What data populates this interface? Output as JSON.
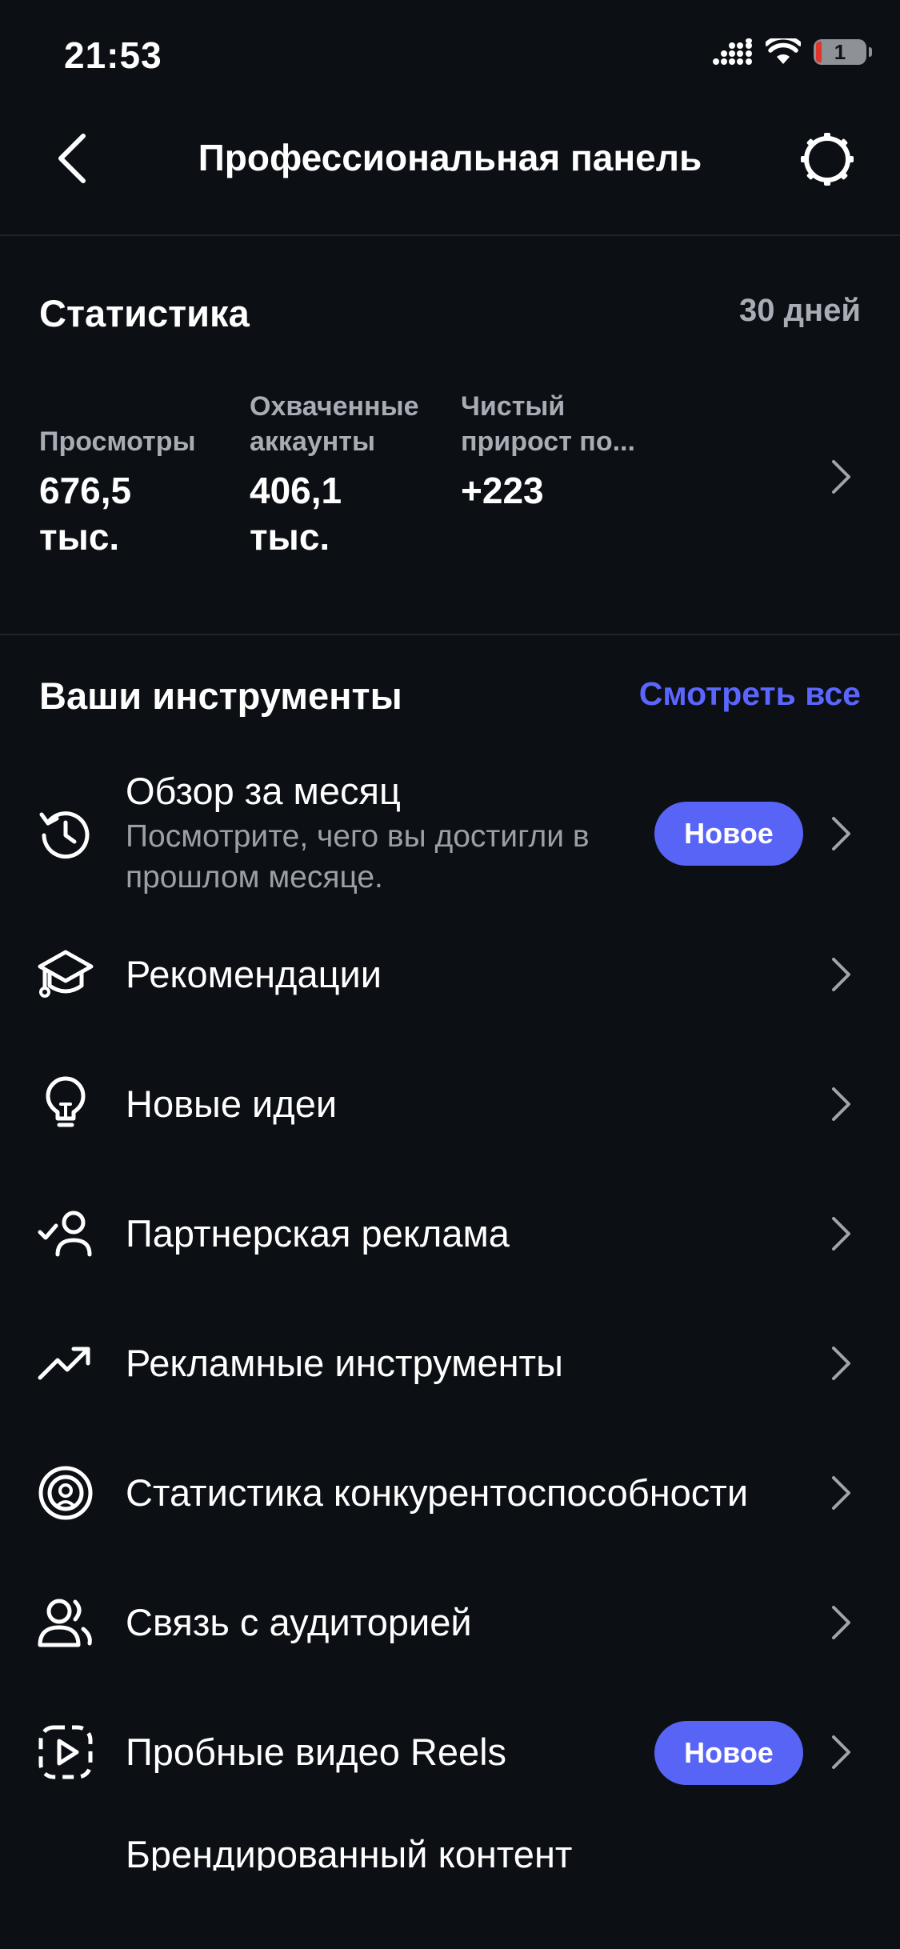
{
  "status_bar": {
    "time": "21:53",
    "battery": "1"
  },
  "header": {
    "title": "Профессиональная панель"
  },
  "stats": {
    "title": "Статистика",
    "range": "30 дней",
    "items": [
      {
        "label_line1": "",
        "label_line2": "Просмотры",
        "value_line1": "676,5",
        "value_line2": "тыс."
      },
      {
        "label_line1": "Охваченные",
        "label_line2": "аккаунты",
        "value_line1": "406,1",
        "value_line2": "тыс."
      },
      {
        "label_line1": "Чистый",
        "label_line2": "прирост по...",
        "value_line1": "+223",
        "value_line2": ""
      }
    ]
  },
  "tools": {
    "title": "Ваши инструменты",
    "see_all": "Смотреть все",
    "items": [
      {
        "label": "Обзор за месяц",
        "sub_line1": "Посмотрите, чего вы достигли в",
        "sub_line2": "прошлом месяце.",
        "badge": "Новое",
        "icon": "history-clock-icon"
      },
      {
        "label": "Рекомендации",
        "icon": "graduation-cap-icon"
      },
      {
        "label": "Новые идеи",
        "icon": "lightbulb-icon"
      },
      {
        "label": "Партнерская реклама",
        "icon": "person-check-icon"
      },
      {
        "label": "Рекламные инструменты",
        "icon": "trending-up-icon"
      },
      {
        "label": "Статистика конкурентоспособности",
        "icon": "target-person-icon"
      },
      {
        "label": "Связь с аудиторией",
        "icon": "audience-icon"
      },
      {
        "label": "Пробные видео Reels",
        "badge": "Новое",
        "icon": "reels-play-icon"
      },
      {
        "label": "Брендированный контент"
      }
    ]
  },
  "colors": {
    "background": "#0c0f14",
    "accent": "#5b66ff",
    "badge": "#5864f5",
    "muted_text": "#a8acb4"
  }
}
